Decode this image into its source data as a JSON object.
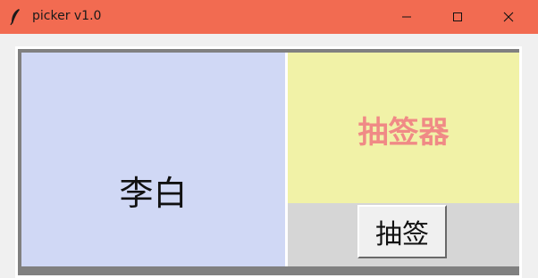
{
  "window": {
    "title": "picker v1.0",
    "title_bar_color": "#f26b51",
    "app_icon": "feather-icon",
    "controls": [
      "minimize-icon",
      "maximize-icon",
      "close-icon"
    ]
  },
  "display": {
    "picked_name": "李白",
    "app_title": "抽签器",
    "left_bg": "#d0d8f5",
    "right_bg": "#f1f2a7",
    "title_color": "#f08a86"
  },
  "actions": {
    "draw_label": "抽签"
  }
}
